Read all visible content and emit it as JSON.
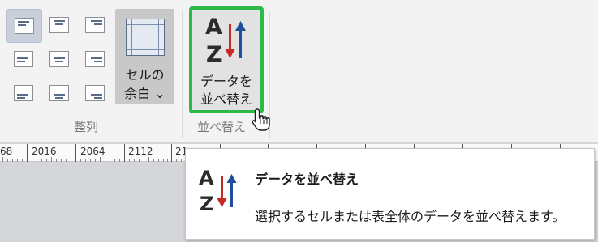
{
  "ribbon": {
    "alignment": {
      "group_label": "整列",
      "buttons": [
        {
          "name": "top-left",
          "selected": true
        },
        {
          "name": "top-center",
          "selected": false
        },
        {
          "name": "top-right",
          "selected": false
        },
        {
          "name": "middle-left",
          "selected": false
        },
        {
          "name": "middle-center",
          "selected": false
        },
        {
          "name": "middle-right",
          "selected": false
        },
        {
          "name": "bottom-left",
          "selected": false
        },
        {
          "name": "bottom-center",
          "selected": false
        },
        {
          "name": "bottom-right",
          "selected": false
        }
      ]
    },
    "cell_margins": {
      "label_line1": "セルの",
      "label_line2": "余白 ⌄"
    },
    "sort": {
      "group_label": "並べ替え",
      "label_line1": "データを",
      "label_line2": "並べ替え",
      "highlight_color": "#2db84a"
    }
  },
  "ruler": {
    "labels": [
      "68",
      "2016",
      "2064",
      "2112",
      "21"
    ]
  },
  "tooltip": {
    "title": "データを並べ替え",
    "description": "選択するセルまたは表全体のデータを並べ替えます。"
  },
  "icons": {
    "sort_icon": "az-sort-icon",
    "cursor": "hand-pointer-icon",
    "arrow_down_color": "#c62828",
    "arrow_up_color": "#1f4e9c"
  }
}
